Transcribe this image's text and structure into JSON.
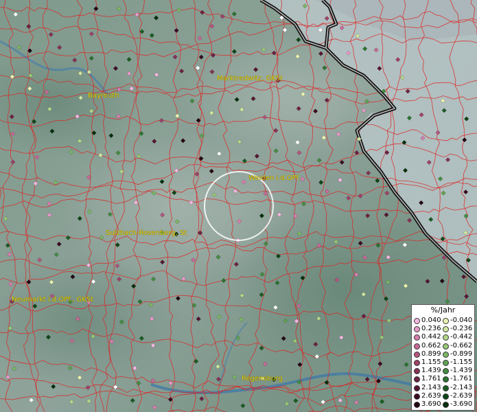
{
  "map": {
    "cities": [
      {
        "name": "Bayreuth"
      },
      {
        "name": "Marktredwitz, GKSt"
      },
      {
        "name": "Weiden i.d.OPf."
      },
      {
        "name": "Sulzbach-Rosenberg, St"
      },
      {
        "name": "Neumarkt i.d.OPf., GKSt"
      },
      {
        "name": "Regensburg"
      }
    ]
  },
  "legend": {
    "title": "%/Jahr",
    "positive": [
      {
        "value": "0.040",
        "color": "#f4b6e0"
      },
      {
        "value": "0.236",
        "color": "#e69ac8"
      },
      {
        "value": "0.442",
        "color": "#d77eae"
      },
      {
        "value": "0.662",
        "color": "#c66a98"
      },
      {
        "value": "0.899",
        "color": "#b35680"
      },
      {
        "value": "1.155",
        "color": "#9e4269"
      },
      {
        "value": "1.439",
        "color": "#873255"
      },
      {
        "value": "1.761",
        "color": "#6e2242"
      },
      {
        "value": "2.143",
        "color": "#561632"
      },
      {
        "value": "2.639",
        "color": "#3c0c22"
      },
      {
        "value": "3.690",
        "color": "#240614"
      }
    ],
    "negative": [
      {
        "value": "-0.040",
        "color": "#e9f2b0"
      },
      {
        "value": "-0.236",
        "color": "#cfe5a0"
      },
      {
        "value": "-0.442",
        "color": "#b3d58a"
      },
      {
        "value": "-0.662",
        "color": "#98c678"
      },
      {
        "value": "-0.899",
        "color": "#7cb666"
      },
      {
        "value": "-1.155",
        "color": "#5fa253"
      },
      {
        "value": "-1.439",
        "color": "#448c42"
      },
      {
        "value": "-1.761",
        "color": "#2c7431"
      },
      {
        "value": "-2.143",
        "color": "#1a5d22"
      },
      {
        "value": "-2.639",
        "color": "#0e4616"
      },
      {
        "value": "-3.690",
        "color": "#06300c"
      }
    ]
  },
  "style": {
    "border_color": "#e02020",
    "label_color": "#e8d000"
  }
}
